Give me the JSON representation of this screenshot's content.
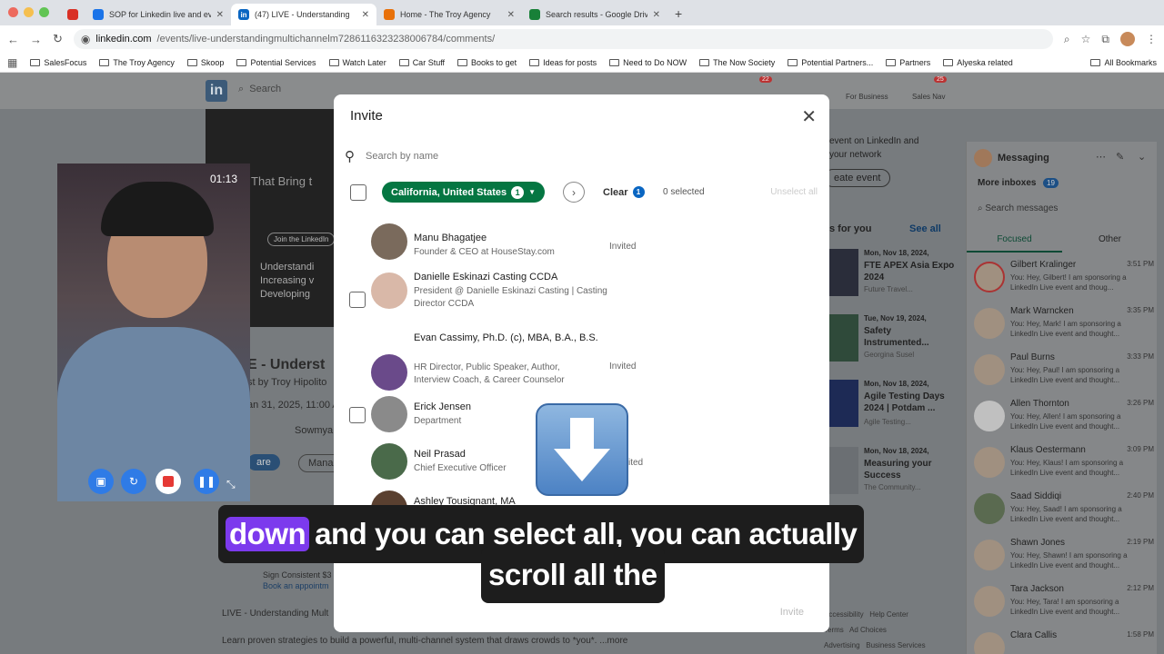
{
  "browser": {
    "tabs": [
      {
        "title": "SOP for Linkedin live and eve",
        "color": "#1a73e8"
      },
      {
        "title": "(47) LIVE - Understanding",
        "color": "#0a66c2"
      },
      {
        "title": "Home - The Troy Agency",
        "color": "#e8710a"
      },
      {
        "title": "Search results - Google Drive",
        "color": "#188038"
      }
    ],
    "url_host": "linkedin.com",
    "url_path": "/events/live-understandingmultichannelm7286116323238006784/comments/",
    "bookmarks": [
      "SalesFocus",
      "The Troy Agency",
      "Skoop",
      "Potential Services",
      "Watch Later",
      "Car Stuff",
      "Books to get",
      "Ideas for posts",
      "Need to Do NOW",
      "The Now Society",
      "Potential Partners...",
      "Partners",
      "Alyeska related"
    ],
    "all_bookmarks": "All Bookmarks"
  },
  "linkedin": {
    "search_placeholder": "Search",
    "for_business": "For Business",
    "sales_nav": "Sales Nav",
    "notif_count": "22",
    "sales_count": "25",
    "event_tagline": "That Bring t",
    "event_title": "E - Underst",
    "event_by": "st by Troy Hipolito",
    "event_date": "an 31, 2025, 11:00 A",
    "attendee": "Sowmya",
    "share": "are",
    "manage": "Mana",
    "bullets": [
      "Understandi",
      "Increasing v",
      "Developing"
    ],
    "join_btn": "Join the LinkedIn",
    "poster": "Troy Hipolito",
    "poster_sub": "Sign Consistent $3",
    "poster_link": "Book an appointm",
    "post_line1": "LIVE - Understanding Mult",
    "post_line2": "Learn proven strategies to build a powerful, multi-channel system that draws crowds to *you*.",
    "more": "...more",
    "right_create_text": "event on LinkedIn and",
    "right_create_text2": "your network",
    "create_event": "eate event",
    "for_you": "s for you",
    "see_all": "See all",
    "events": [
      {
        "date": "Mon, Nov 18, 2024,",
        "title": "FTE APEX Asia Expo 2024",
        "sub": "Future Travel..."
      },
      {
        "date": "Tue, Nov 19, 2024,",
        "title": "Safety Instrumented...",
        "sub": "Georgina Susel"
      },
      {
        "date": "Mon, Nov 18, 2024,",
        "title": "Agile Testing Days 2024 | Potdam ...",
        "sub": "Agile Testing..."
      },
      {
        "date": "Mon, Nov 18, 2024,",
        "title": "Measuring your Success",
        "sub": "The Community..."
      }
    ],
    "footer_links": [
      "Accessibility",
      "Help Center",
      "Terms",
      "Ad Choices",
      "Advertising",
      "Business Services"
    ]
  },
  "messaging": {
    "title": "Messaging",
    "more_inboxes": "More inboxes",
    "more_count": "19",
    "search_placeholder": "Search messages",
    "tab_focused": "Focused",
    "tab_other": "Other",
    "rows": [
      {
        "name": "Gilbert Kralinger",
        "time": "3:51 PM",
        "snippet": "You: Hey, Gilbert! I am sponsoring a LinkedIn Live event and thoug..."
      },
      {
        "name": "Mark Warncken",
        "time": "3:35 PM",
        "snippet": "You: Hey, Mark! I am sponsoring a LinkedIn Live event and thought..."
      },
      {
        "name": "Paul Burns",
        "time": "3:33 PM",
        "snippet": "You: Hey, Paul! I am sponsoring a LinkedIn Live event and thought..."
      },
      {
        "name": "Allen Thornton",
        "time": "3:26 PM",
        "snippet": "You: Hey, Allen! I am sponsoring a LinkedIn Live event and thought..."
      },
      {
        "name": "Klaus Oestermann",
        "time": "3:09 PM",
        "snippet": "You: Hey, Klaus! I am sponsoring a LinkedIn Live event and thought..."
      },
      {
        "name": "Saad Siddiqi",
        "time": "2:40 PM",
        "snippet": "You: Hey, Saad! I am sponsoring a LinkedIn Live event and thought..."
      },
      {
        "name": "Shawn Jones",
        "time": "2:19 PM",
        "snippet": "You: Hey, Shawn! I am sponsoring a LinkedIn Live event and thought..."
      },
      {
        "name": "Tara Jackson",
        "time": "2:12 PM",
        "snippet": "You: Hey, Tara! I am sponsoring a LinkedIn Live event and thought..."
      },
      {
        "name": "Clara Callis",
        "time": "1:58 PM",
        "snippet": ""
      }
    ]
  },
  "video": {
    "time": "01:13"
  },
  "invite": {
    "title": "Invite",
    "search_placeholder": "Search by name",
    "filter_label": "California, United States",
    "filter_count": "1",
    "clear_label": "Clear",
    "clear_count": "1",
    "selected": "0 selected",
    "unselect_all": "Unselect all",
    "invite_button": "Invite",
    "people": [
      {
        "name": "Manu Bhagatjee",
        "title": "Founder & CEO at HouseStay.com",
        "status": "Invited",
        "checkbox": false
      },
      {
        "name": "Danielle Eskinazi Casting CCDA",
        "title": "President @ Danielle Eskinazi Casting | Casting Director CCDA",
        "status": "",
        "checkbox": true
      },
      {
        "name": "Evan Cassimy, Ph.D. (c), MBA, B.A., B.S.",
        "title": "HR Director, Public Speaker, Author, Interview Coach, & Career Counselor",
        "status": "Invited",
        "checkbox": false
      },
      {
        "name": "Erick Jensen",
        "title": "Department",
        "status": "",
        "checkbox": true
      },
      {
        "name": "Neil Prasad",
        "title": "Chief Executive Officer",
        "status": "ited",
        "checkbox": false
      },
      {
        "name": "Ashley Tousignant, MA",
        "title": "",
        "status": "",
        "checkbox": false
      }
    ]
  },
  "captions": {
    "line1_highlight": "down",
    "line1_rest": "and you can select all, you can actually",
    "line2": "scroll all the"
  }
}
